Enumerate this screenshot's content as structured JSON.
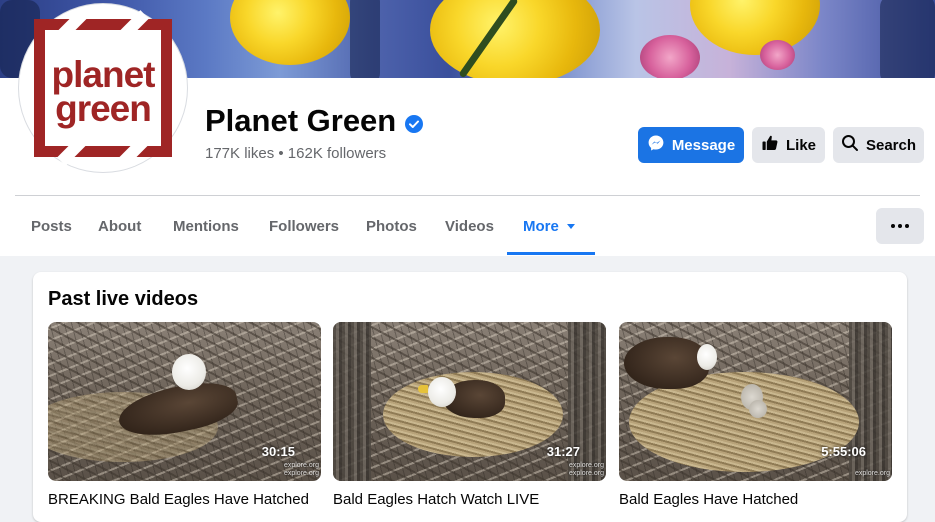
{
  "page": {
    "name": "Planet Green",
    "stats": "177K likes • 162K followers",
    "logo_line1": "planet",
    "logo_line2": "green"
  },
  "actions": {
    "message": "Message",
    "like": "Like",
    "search": "Search"
  },
  "tabs": [
    {
      "label": "Posts"
    },
    {
      "label": "About"
    },
    {
      "label": "Mentions"
    },
    {
      "label": "Followers"
    },
    {
      "label": "Photos"
    },
    {
      "label": "Videos"
    },
    {
      "label": "More",
      "active": true
    }
  ],
  "section": {
    "title": "Past live videos",
    "videos": [
      {
        "duration": "30:15",
        "title": "BREAKING Bald Eagles Have Hatched",
        "watermark_top": "explore.org",
        "watermark_bottom": "explore.org"
      },
      {
        "duration": "31:27",
        "title": "Bald Eagles Hatch Watch LIVE",
        "watermark_top": "explore.org",
        "watermark_bottom": "explore.org"
      },
      {
        "duration": "5:55:06",
        "title": "Bald Eagles Have Hatched",
        "watermark_top": "explore.org",
        "watermark_bottom": "explore.org"
      }
    ]
  },
  "icons": {
    "verified": "verified-badge-icon",
    "message": "messenger-icon",
    "like": "thumbs-up-icon",
    "search": "search-icon",
    "more": "more-dots-icon",
    "dropdown": "caret-down-icon"
  },
  "colors": {
    "accent": "#1877f2",
    "message_button": "#1b74e4",
    "secondary_button": "#e4e6eb",
    "logo_red": "#9f2525",
    "page_background": "#f0f2f5"
  }
}
